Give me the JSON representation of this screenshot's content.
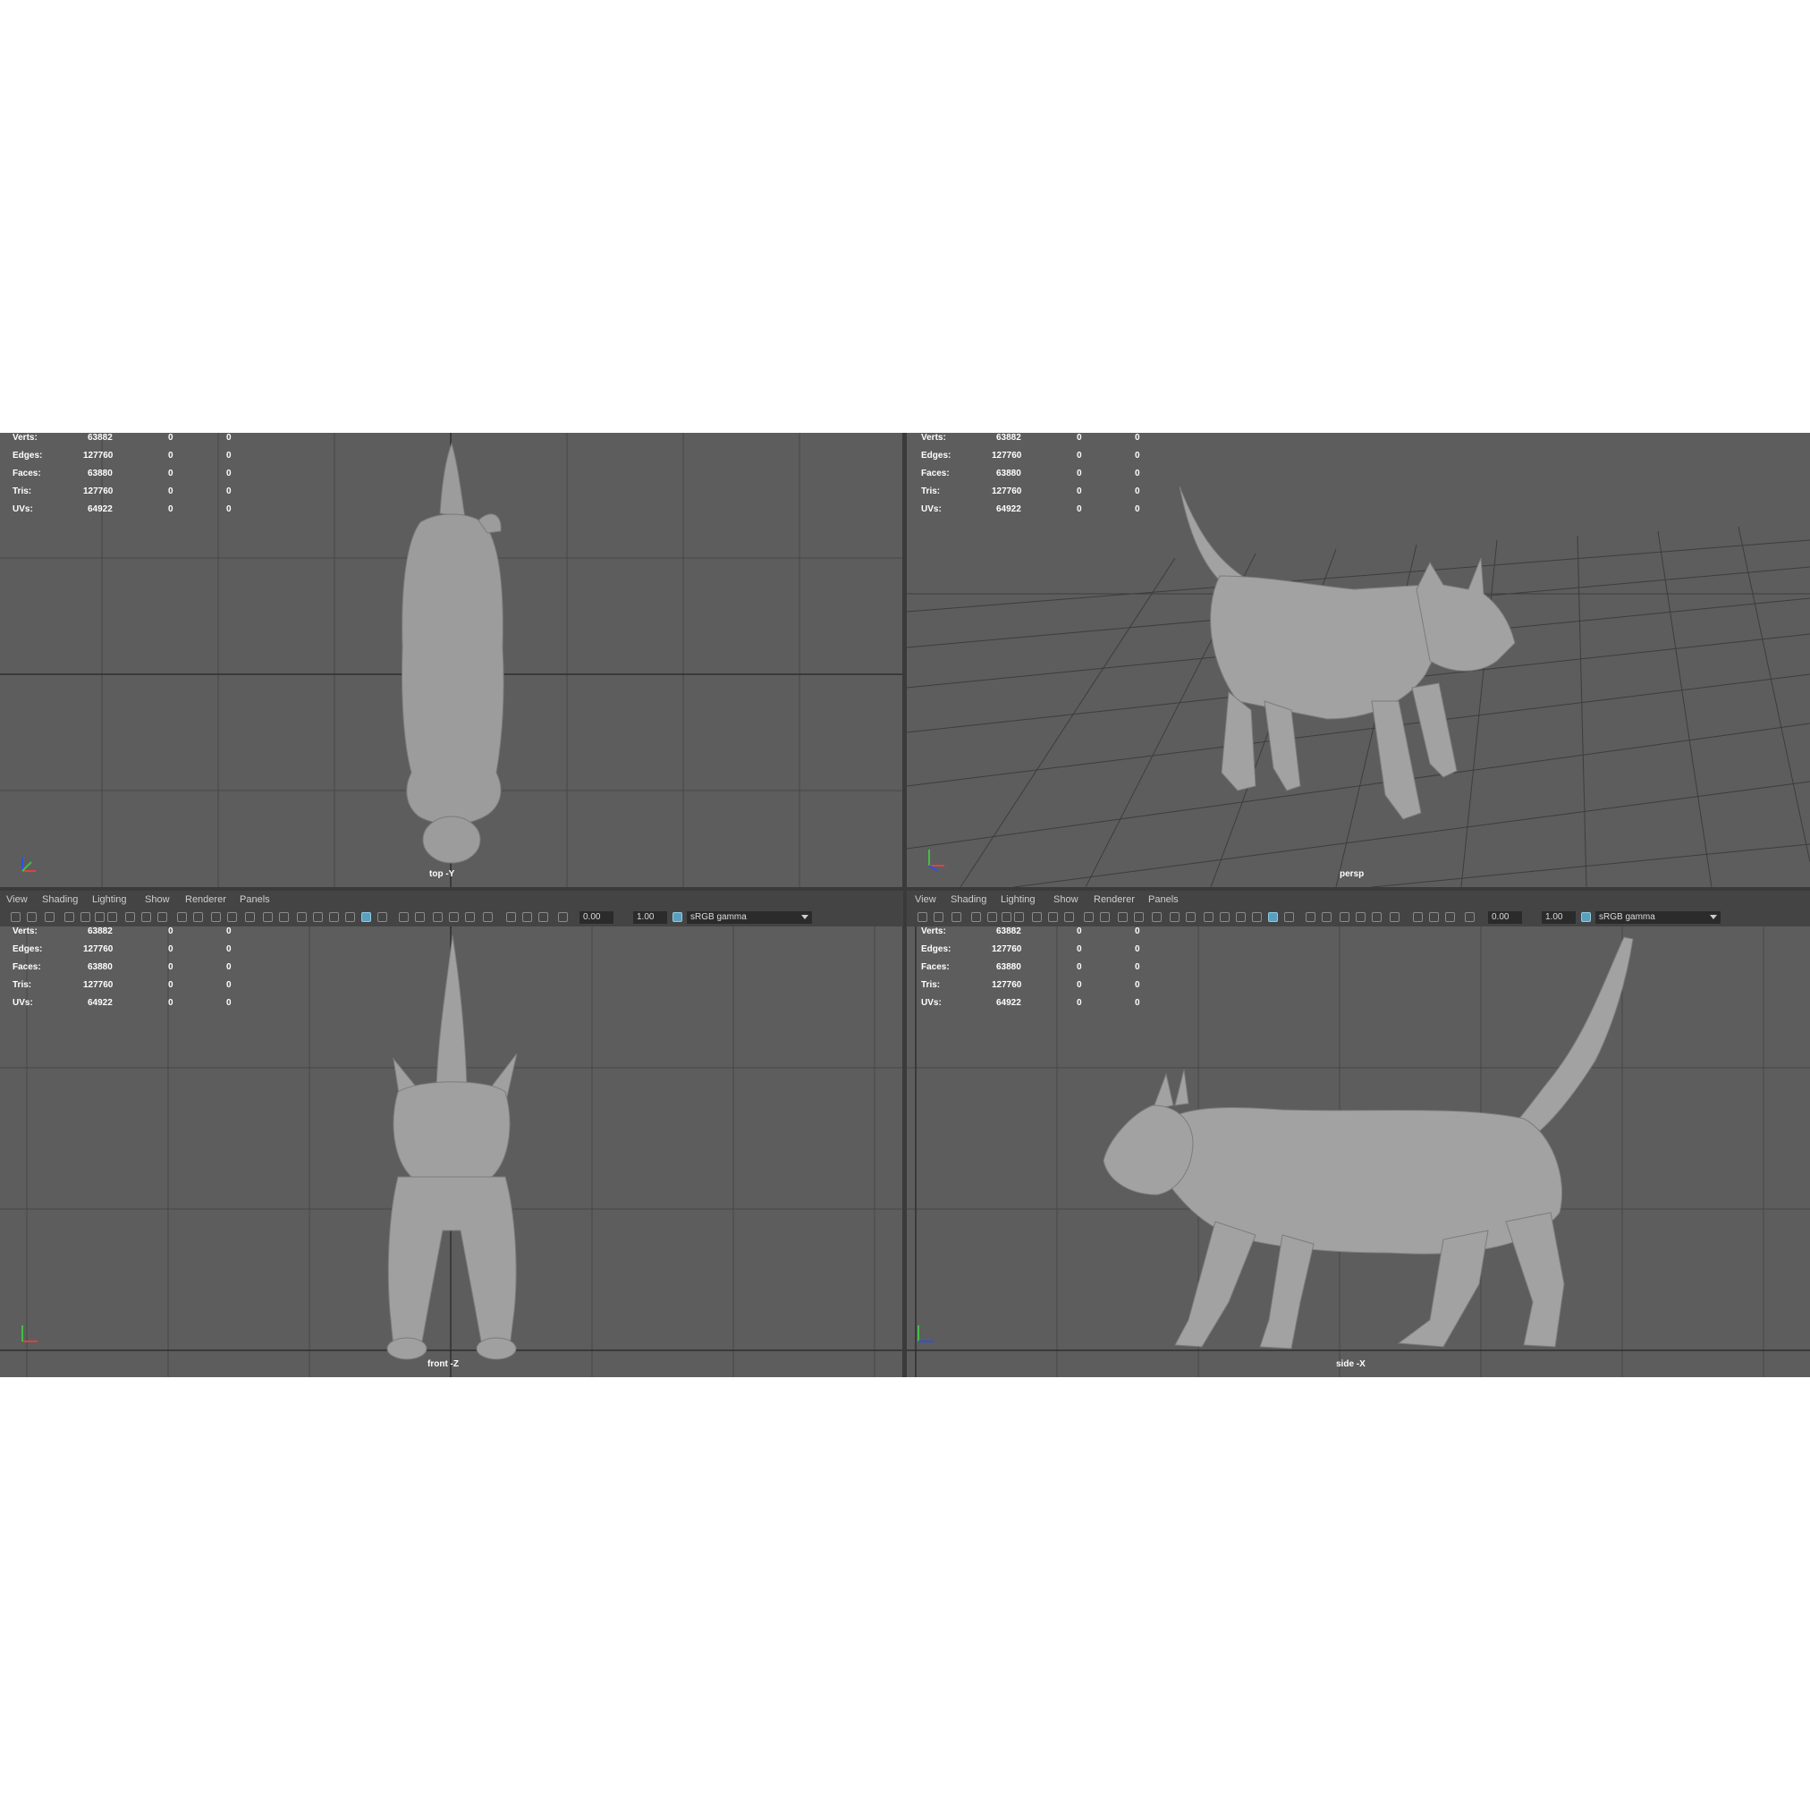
{
  "panel_menu": [
    "View",
    "Shading",
    "Lighting",
    "Show",
    "Renderer",
    "Panels"
  ],
  "toolbar": {
    "exposure_value": "0.00",
    "gamma_value": "1.00",
    "color_space": "sRGB gamma"
  },
  "hud": {
    "rows": [
      {
        "label": "Verts:",
        "value": "63882",
        "c2": "0",
        "c3": "0"
      },
      {
        "label": "Edges:",
        "value": "127760",
        "c2": "0",
        "c3": "0"
      },
      {
        "label": "Faces:",
        "value": "63880",
        "c2": "0",
        "c3": "0"
      },
      {
        "label": "Tris:",
        "value": "127760",
        "c2": "0",
        "c3": "0"
      },
      {
        "label": "UVs:",
        "value": "64922",
        "c2": "0",
        "c3": "0"
      }
    ]
  },
  "viewports": {
    "top": {
      "camera": "top -Y"
    },
    "persp": {
      "camera": "persp"
    },
    "front": {
      "camera": "front -Z"
    },
    "side": {
      "camera": "side -X"
    }
  },
  "colors": {
    "viewport_bg": "#5d5d5d",
    "model": "#9a9a9a",
    "accent": "#5b9fbf"
  }
}
